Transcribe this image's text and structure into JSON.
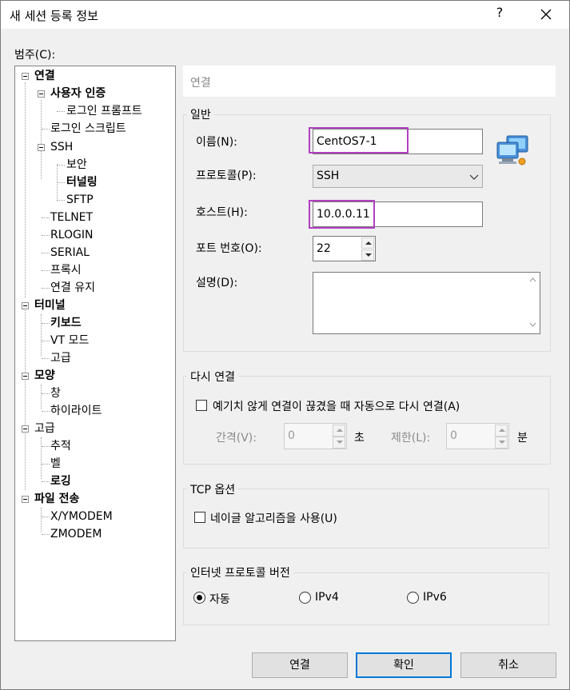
{
  "window": {
    "title": "새 세션 등록 정보",
    "help_glyph": "?",
    "close_glyph": "✕"
  },
  "category_label": "범주(C):",
  "tree": {
    "items": [
      {
        "label": "연결"
      },
      {
        "label": "사용자 인증"
      },
      {
        "label": "로그인 프롬프트"
      },
      {
        "label": "로그인 스크립트"
      },
      {
        "label": "SSH"
      },
      {
        "label": "보안"
      },
      {
        "label": "터널링"
      },
      {
        "label": "SFTP"
      },
      {
        "label": "TELNET"
      },
      {
        "label": "RLOGIN"
      },
      {
        "label": "SERIAL"
      },
      {
        "label": "프록시"
      },
      {
        "label": "연결 유지"
      },
      {
        "label": "터미널"
      },
      {
        "label": "키보드"
      },
      {
        "label": "VT 모드"
      },
      {
        "label": "고급"
      },
      {
        "label": "모양"
      },
      {
        "label": "창"
      },
      {
        "label": "하이라이트"
      },
      {
        "label": "고급"
      },
      {
        "label": "추적"
      },
      {
        "label": "벨"
      },
      {
        "label": "로깅"
      },
      {
        "label": "파일 전송"
      },
      {
        "label": "X/YMODEM"
      },
      {
        "label": "ZMODEM"
      }
    ]
  },
  "panel": {
    "header": "연결",
    "general": {
      "title": "일반",
      "name_label": "이름(N):",
      "name_value": "CentOS7-1",
      "protocol_label": "프로토콜(P):",
      "protocol_value": "SSH",
      "host_label": "호스트(H):",
      "host_value": "10.0.0.11",
      "port_label": "포트 번호(O):",
      "port_value": "22",
      "desc_label": "설명(D):",
      "desc_value": ""
    },
    "reconnect": {
      "title": "다시 연결",
      "checkbox_label": "예기치 않게 연결이 끊겼을 때 자동으로 다시 연결(A)",
      "interval_label": "간격(V):",
      "interval_value": "0",
      "interval_unit": "초",
      "limit_label": "제한(L):",
      "limit_value": "0",
      "limit_unit": "분"
    },
    "tcp": {
      "title": "TCP 옵션",
      "nagle_label": "네이글 알고리즘을 사용(U)"
    },
    "ip": {
      "title": "인터넷 프로토콜 버전",
      "options": [
        {
          "label": "자동",
          "selected": true
        },
        {
          "label": "IPv4",
          "selected": false
        },
        {
          "label": "IPv6",
          "selected": false
        }
      ]
    }
  },
  "buttons": {
    "connect": "연결",
    "ok": "확인",
    "cancel": "취소"
  },
  "colors": {
    "highlight": "#b040c0",
    "default_button_border": "#0078d7"
  }
}
